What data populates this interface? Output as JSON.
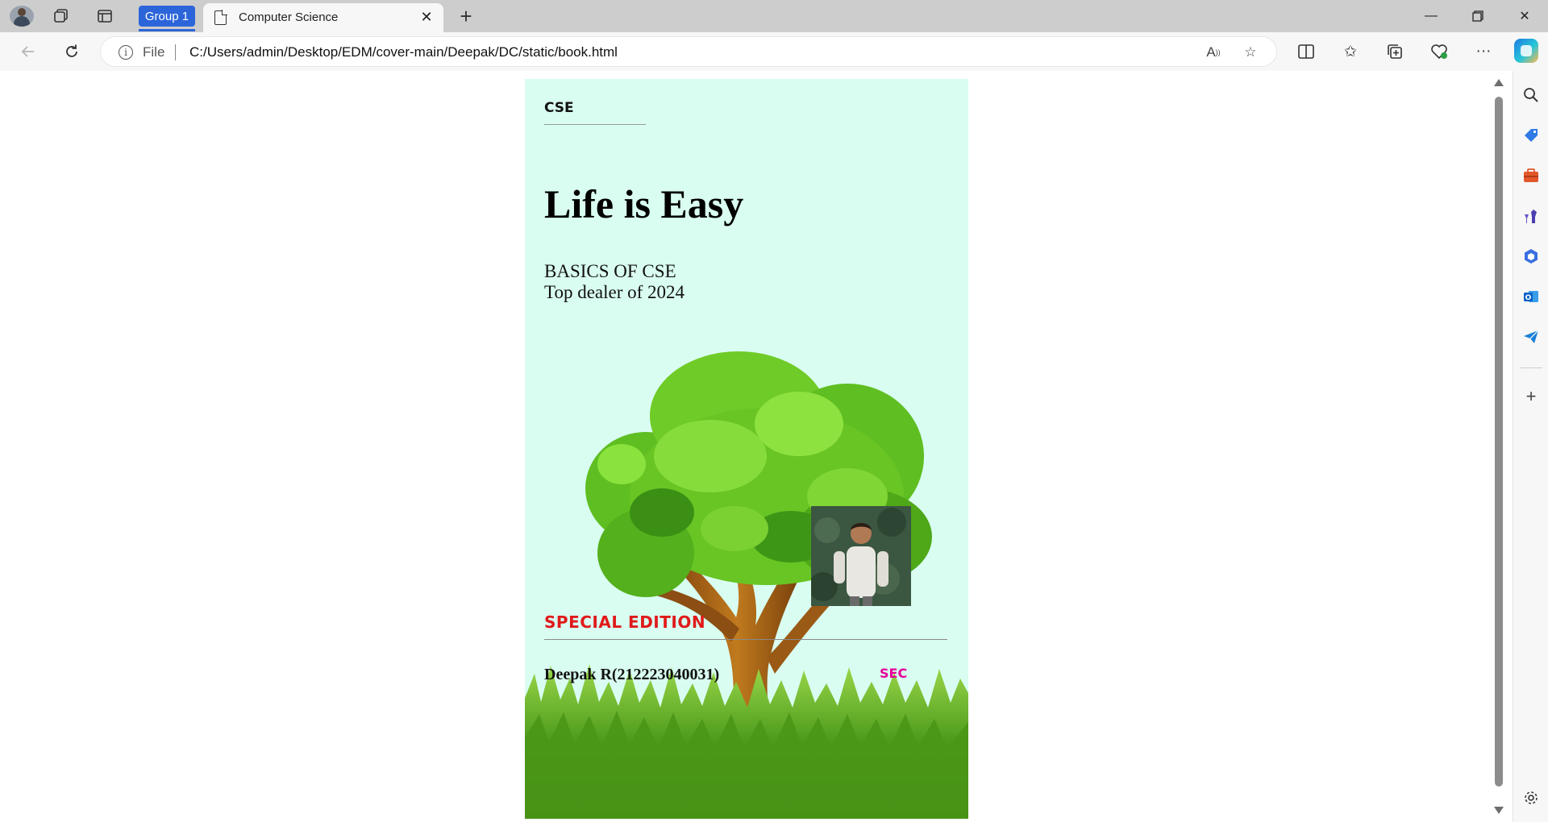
{
  "browser": {
    "tab_group_label": "Group 1",
    "tab_title": "Computer Science",
    "address_scheme": "File",
    "url": "C:/Users/admin/Desktop/EDM/cover-main/Deepak/DC/static/book.html"
  },
  "cover": {
    "category": "CSE",
    "title": "Life is Easy",
    "subtitle": "BASICS OF CSE",
    "tagline": "Top dealer of 2024",
    "edition": "SPECIAL EDITION",
    "author": "Deepak R(212223040031)",
    "section": "SEC",
    "colors": {
      "background": "#d9fdf1",
      "edition": "#e01a1a",
      "section": "#e6009a"
    }
  }
}
